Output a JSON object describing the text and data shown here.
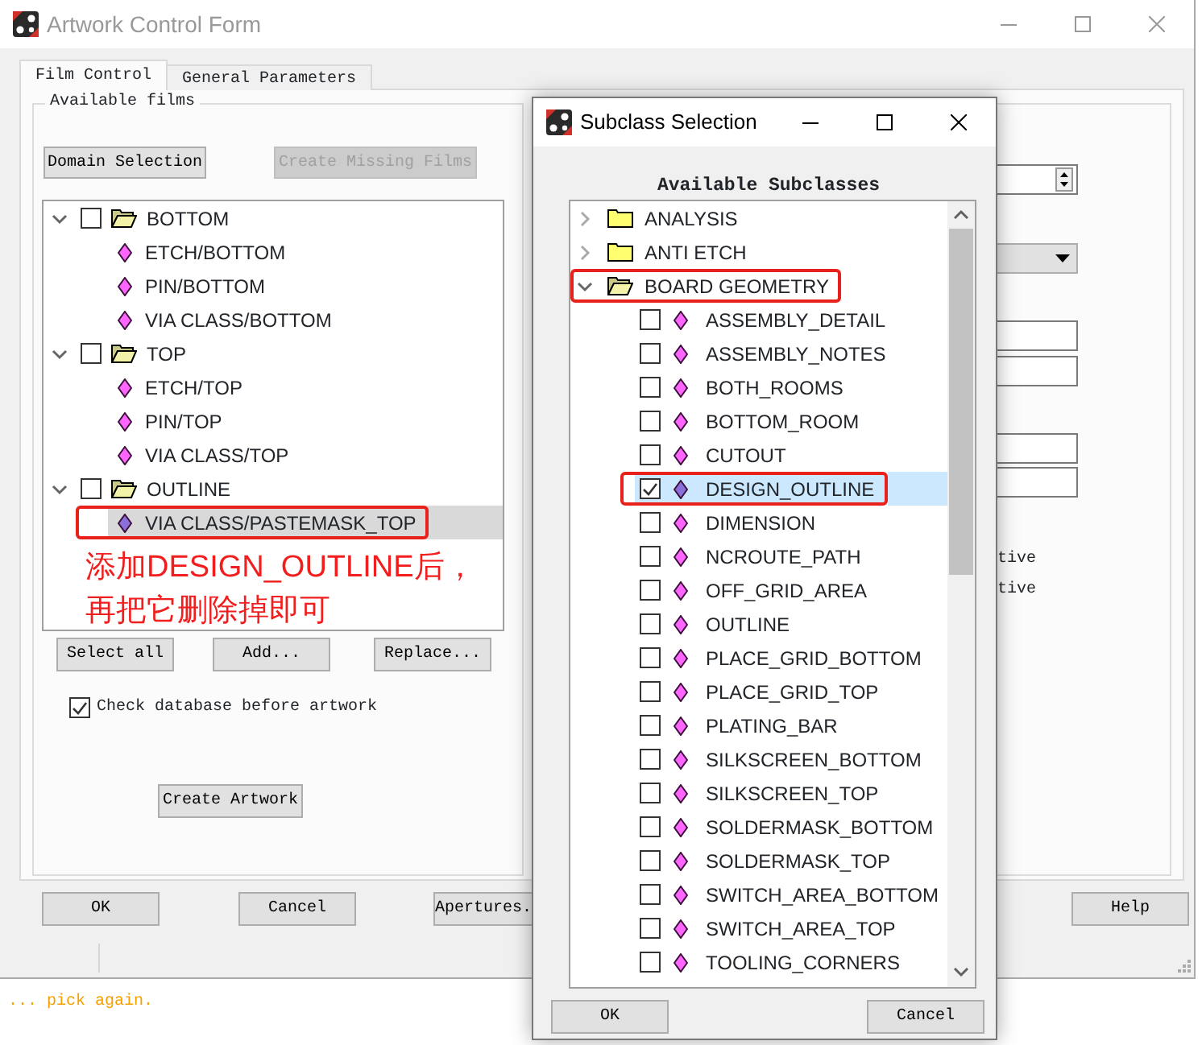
{
  "main_window": {
    "title": "Artwork Control Form",
    "tabs": [
      {
        "label": "Film Control",
        "selected": true
      },
      {
        "label": "General Parameters",
        "selected": false
      }
    ],
    "film_panel": {
      "group_title": "Available films",
      "top_buttons": [
        {
          "label": "Domain Selection",
          "disabled": false
        },
        {
          "label": "Create Missing Films",
          "disabled": true
        }
      ],
      "films": [
        {
          "label": "BOTTOM",
          "expanded": true,
          "checked": false,
          "children": [
            {
              "label": "ETCH/BOTTOM",
              "selected": false,
              "highlighted": false
            },
            {
              "label": "PIN/BOTTOM",
              "selected": false,
              "highlighted": false
            },
            {
              "label": "VIA CLASS/BOTTOM",
              "selected": false,
              "highlighted": false
            }
          ]
        },
        {
          "label": "TOP",
          "expanded": true,
          "checked": false,
          "children": [
            {
              "label": "ETCH/TOP",
              "selected": false,
              "highlighted": false
            },
            {
              "label": "PIN/TOP",
              "selected": false,
              "highlighted": false
            },
            {
              "label": "VIA CLASS/TOP",
              "selected": false,
              "highlighted": false
            }
          ]
        },
        {
          "label": "OUTLINE",
          "expanded": true,
          "checked": false,
          "children": [
            {
              "label": "VIA CLASS/PASTEMASK_TOP",
              "selected": true,
              "highlighted": true
            }
          ]
        }
      ],
      "annotation": [
        "添加DESIGN_OUTLINE后，",
        "再把它删除掉即可"
      ],
      "list_buttons": [
        "Select all",
        "Add...",
        "Replace..."
      ],
      "check_database": {
        "label": "Check database before artwork",
        "checked": true
      },
      "create_button": "Create Artwork"
    },
    "settings_panel": {
      "option_texts": [
        "tive",
        "tive"
      ]
    },
    "buttons": [
      "OK",
      "Cancel",
      "Apertures.",
      "Help"
    ]
  },
  "status_text": "... pick again.",
  "dialog": {
    "title": "Subclass Selection",
    "heading": "Available Subclasses",
    "classes": [
      {
        "label": "ANALYSIS",
        "expanded": false,
        "highlighted": false
      },
      {
        "label": "ANTI ETCH",
        "expanded": false,
        "highlighted": false
      },
      {
        "label": "BOARD GEOMETRY",
        "expanded": true,
        "highlighted": true,
        "children": [
          {
            "label": "ASSEMBLY_DETAIL",
            "checked": false,
            "selected": false,
            "highlighted": false
          },
          {
            "label": "ASSEMBLY_NOTES",
            "checked": false,
            "selected": false,
            "highlighted": false
          },
          {
            "label": "BOTH_ROOMS",
            "checked": false,
            "selected": false,
            "highlighted": false
          },
          {
            "label": "BOTTOM_ROOM",
            "checked": false,
            "selected": false,
            "highlighted": false
          },
          {
            "label": "CUTOUT",
            "checked": false,
            "selected": false,
            "highlighted": false
          },
          {
            "label": "DESIGN_OUTLINE",
            "checked": true,
            "selected": true,
            "highlighted": true
          },
          {
            "label": "DIMENSION",
            "checked": false,
            "selected": false,
            "highlighted": false
          },
          {
            "label": "NCROUTE_PATH",
            "checked": false,
            "selected": false,
            "highlighted": false
          },
          {
            "label": "OFF_GRID_AREA",
            "checked": false,
            "selected": false,
            "highlighted": false
          },
          {
            "label": "OUTLINE",
            "checked": false,
            "selected": false,
            "highlighted": false
          },
          {
            "label": "PLACE_GRID_BOTTOM",
            "checked": false,
            "selected": false,
            "highlighted": false
          },
          {
            "label": "PLACE_GRID_TOP",
            "checked": false,
            "selected": false,
            "highlighted": false
          },
          {
            "label": "PLATING_BAR",
            "checked": false,
            "selected": false,
            "highlighted": false
          },
          {
            "label": "SILKSCREEN_BOTTOM",
            "checked": false,
            "selected": false,
            "highlighted": false
          },
          {
            "label": "SILKSCREEN_TOP",
            "checked": false,
            "selected": false,
            "highlighted": false
          },
          {
            "label": "SOLDERMASK_BOTTOM",
            "checked": false,
            "selected": false,
            "highlighted": false
          },
          {
            "label": "SOLDERMASK_TOP",
            "checked": false,
            "selected": false,
            "highlighted": false
          },
          {
            "label": "SWITCH_AREA_BOTTOM",
            "checked": false,
            "selected": false,
            "highlighted": false
          },
          {
            "label": "SWITCH_AREA_TOP",
            "checked": false,
            "selected": false,
            "highlighted": false
          },
          {
            "label": "TOOLING_CORNERS",
            "checked": false,
            "selected": false,
            "highlighted": false
          }
        ]
      }
    ],
    "buttons": [
      "OK",
      "Cancel"
    ]
  }
}
